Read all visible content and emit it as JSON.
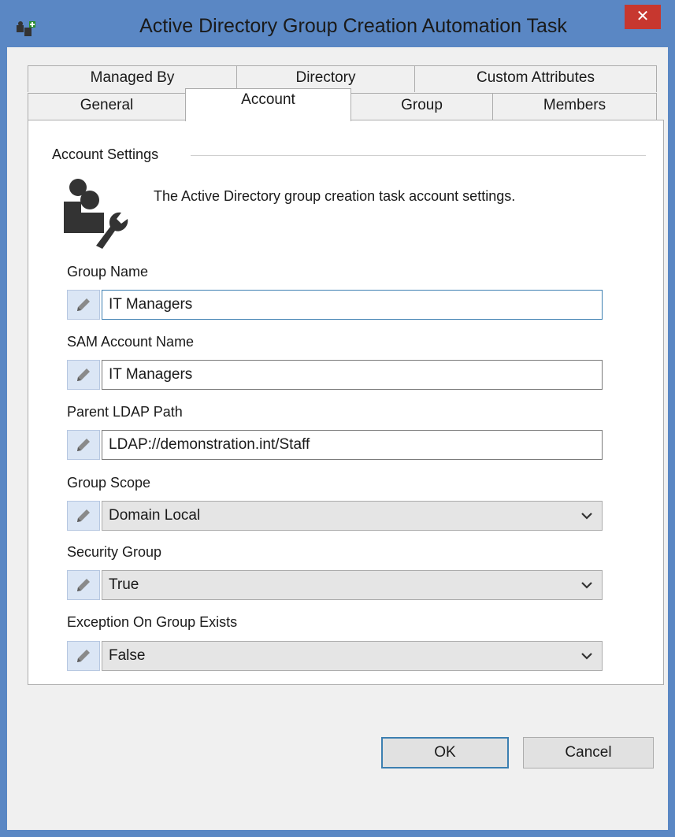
{
  "window": {
    "title": "Active Directory Group Creation Automation Task",
    "close_label": "✕"
  },
  "tabs": {
    "row1": [
      "Managed By",
      "Directory",
      "Custom Attributes"
    ],
    "row2": [
      "General",
      "Account",
      "Group",
      "Members"
    ],
    "active": "Account"
  },
  "account": {
    "section_title": "Account Settings",
    "description": "The Active Directory group creation task account settings.",
    "fields": [
      {
        "label": "Group Name",
        "value": "IT Managers"
      },
      {
        "label": "SAM Account Name",
        "value": "IT Managers"
      },
      {
        "label": "Parent LDAP Path",
        "value": "LDAP://demonstration.int/Staff"
      },
      {
        "label": "Group Scope",
        "value": "Domain Local"
      },
      {
        "label": "Security Group",
        "value": "True"
      },
      {
        "label": "Exception On Group Exists",
        "value": "False"
      }
    ]
  },
  "buttons": {
    "ok": "OK",
    "cancel": "Cancel"
  },
  "colors": {
    "title_bar": "#5a87c4",
    "close_button": "#c7372f",
    "focus_border": "#3c7fb1"
  },
  "icons": [
    "app-icon",
    "account-settings-icon",
    "pencil-icon",
    "chevron-down-icon",
    "close-icon"
  ]
}
